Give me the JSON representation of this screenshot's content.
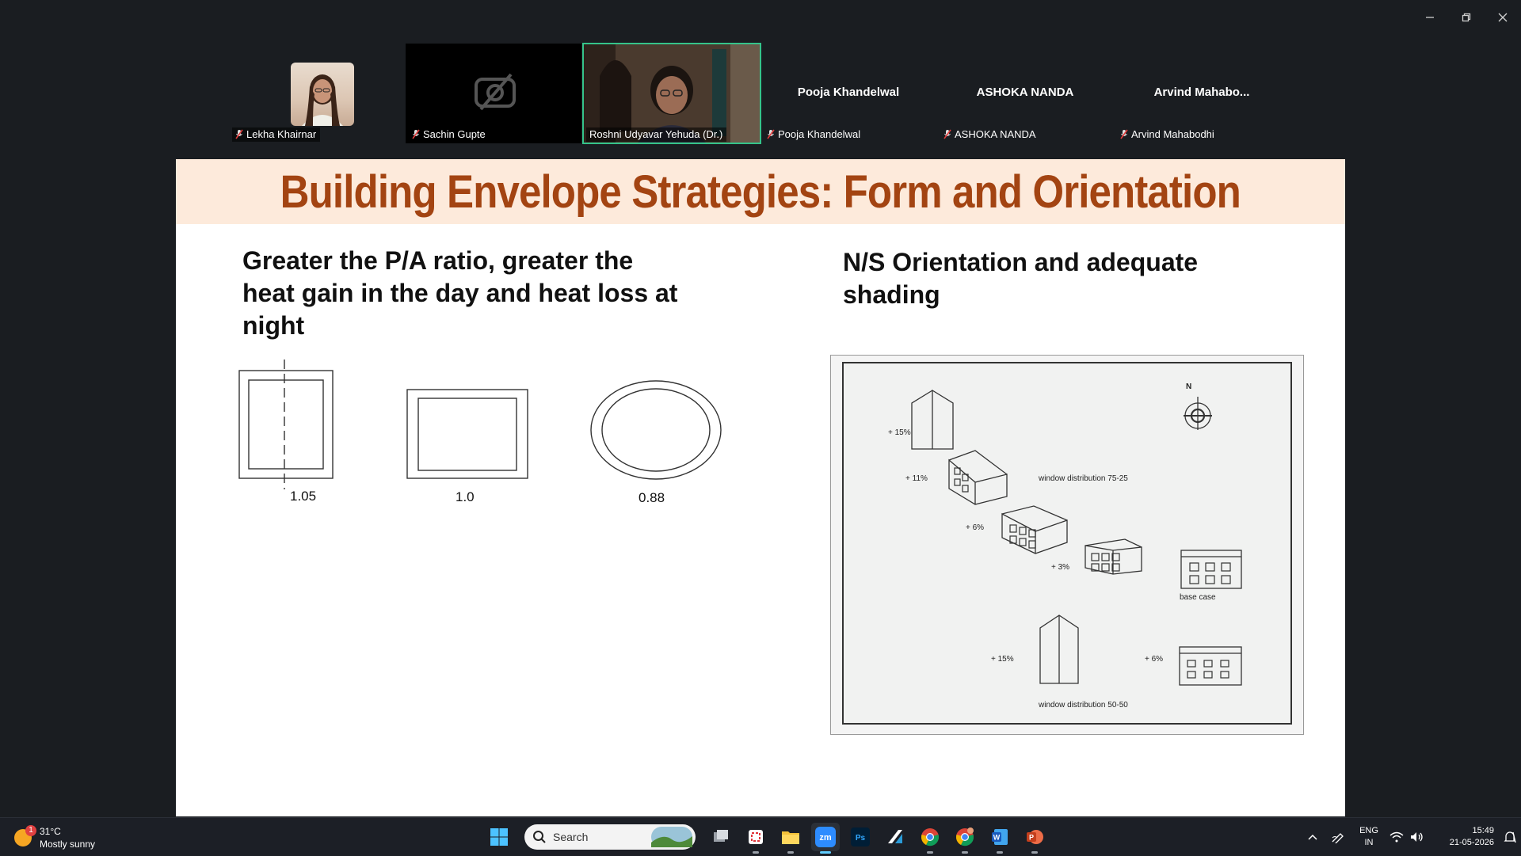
{
  "window": {
    "minimize": "minimize",
    "restore": "restore",
    "close": "close"
  },
  "participants": [
    {
      "name": "Lekha Khairnar",
      "type": "avatar",
      "muted": true
    },
    {
      "name": "Sachin Gupte",
      "type": "video-off",
      "muted": true
    },
    {
      "name": "Roshni Udyavar Yehuda (Dr.)",
      "type": "video",
      "active": true,
      "muted": false
    },
    {
      "name": "Pooja Khandelwal",
      "display": "Pooja Khandelwal",
      "muted": true
    },
    {
      "name": "ASHOKA NANDA",
      "display": "ASHOKA NANDA",
      "muted": true
    },
    {
      "name": "Arvind Mahabodhi",
      "display": "Arvind  Mahabo...",
      "muted": true
    }
  ],
  "slide": {
    "title": "Building Envelope Strategies: Form  and Orientation",
    "left_text": "Greater the P/A ratio, greater the heat gain in the day and heat loss at night",
    "right_text": "N/S Orientation and adequate shading",
    "shapes": [
      {
        "shape": "rectangle-with-axis",
        "ratio": "1.05"
      },
      {
        "shape": "square",
        "ratio": "1.0"
      },
      {
        "shape": "ellipse",
        "ratio": "0.88"
      }
    ],
    "figure": {
      "north": "N",
      "labels": {
        "p15a": "+ 15%",
        "p11": "+ 11%",
        "p6a": "+ 6%",
        "p3": "+ 3%",
        "wd7525": "window distribution 75-25",
        "base": "base case",
        "p15b": "+ 15%",
        "p6b": "+ 6%",
        "wd5050": "window distribution 50-50"
      }
    }
  },
  "taskbar": {
    "weather": {
      "temp": "31°C",
      "condition": "Mostly sunny",
      "badge": "1"
    },
    "search_placeholder": "Search",
    "apps": [
      "windows-start",
      "search",
      "task-view",
      "snipping-tool",
      "file-explorer",
      "zoom",
      "photoshop",
      "autodesk",
      "chrome",
      "chrome-profile",
      "word",
      "powerpoint"
    ],
    "language": "ENG",
    "region": "IN",
    "time": "15:49",
    "date": "21-05-2026"
  },
  "colors": {
    "title": "#a34412",
    "slide_header_bg": "#fdeadb",
    "active_border": "#35c38a",
    "background": "#1a1d21"
  }
}
